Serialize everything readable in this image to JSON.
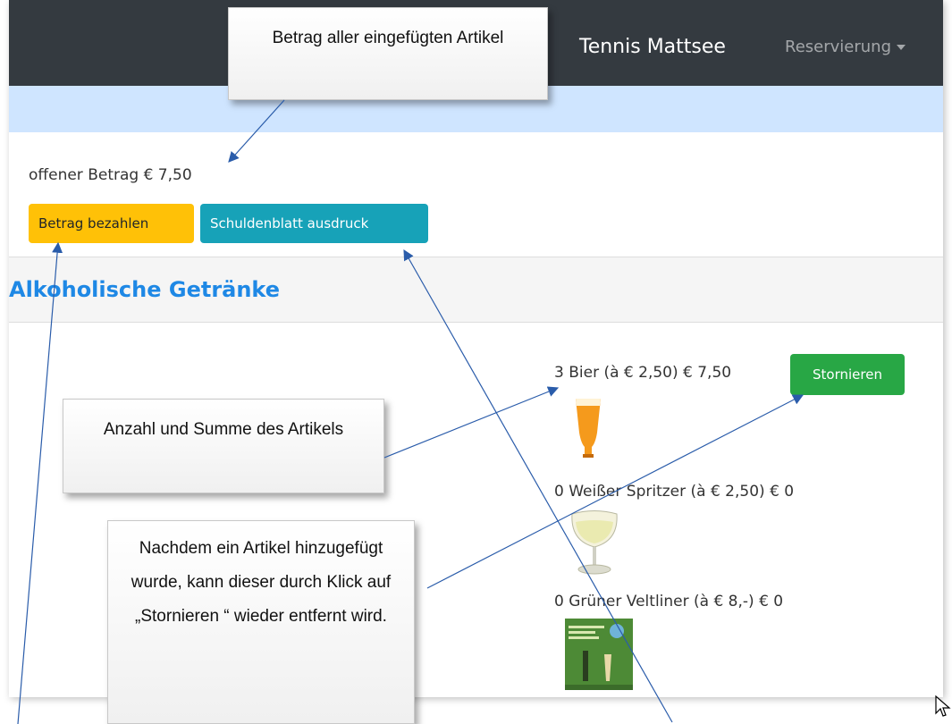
{
  "navbar": {
    "brand": "Tennis Mattsee",
    "menu_label": "Reservierung"
  },
  "account": {
    "open_amount": "offener Betrag € 7,50",
    "pay_button": "Betrag bezahlen",
    "print_button": "Schuldenblatt ausdruck"
  },
  "category": {
    "title": "Alkoholische Getränke"
  },
  "items": [
    {
      "label": "3 Bier (à € 2,50) € 7,50",
      "image": "beer-glass-icon"
    },
    {
      "label": "0 Weißer Spritzer (à € 2,50) € 0",
      "image": "wine-glass-icon"
    },
    {
      "label": "0 Grüner Veltliner (à € 8,-) € 0",
      "image": "wine-label-image"
    }
  ],
  "item_actions": {
    "cancel_button": "Stornieren"
  },
  "callouts": {
    "total": "Betrag aller eingefügten Artikel",
    "count_sum": "Anzahl und Summe des Artikels",
    "cancel_hint": "Nachdem ein Artikel hinzugefügt wurde, kann dieser durch Klick auf „Stornieren “ wieder entfernt wird."
  },
  "colors": {
    "navbar": "#343a40",
    "band": "#cfe5ff",
    "pay": "#ffc107",
    "print": "#17a2b8",
    "cancel": "#28a745",
    "title": "#1e88e5",
    "arrow": "#2a5caa"
  }
}
